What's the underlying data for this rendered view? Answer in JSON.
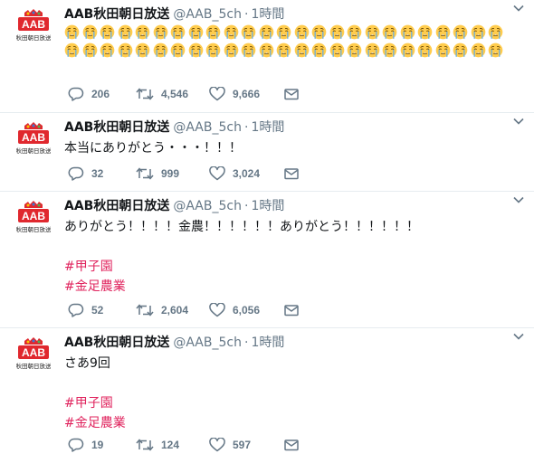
{
  "tweets": [
    {
      "name": "AAB秋田朝日放送",
      "handle": "@AAB_5ch",
      "dot": "·",
      "time": "1時間",
      "emoji_count": 50,
      "emoji_icon": "loudly-crying-face-emoji",
      "replies": "206",
      "retweets": "4,546",
      "likes": "9,666"
    },
    {
      "name": "AAB秋田朝日放送",
      "handle": "@AAB_5ch",
      "dot": "·",
      "time": "1時間",
      "text": "本当にありがとう・・・！！！",
      "replies": "32",
      "retweets": "999",
      "likes": "3,024"
    },
    {
      "name": "AAB秋田朝日放送",
      "handle": "@AAB_5ch",
      "dot": "·",
      "time": "1時間",
      "text": "ありがとう！！！！金農！！！！！！ありがとう！！！！！！",
      "hashtags": [
        "#甲子園",
        "#金足農業"
      ],
      "replies": "52",
      "retweets": "2,604",
      "likes": "6,056"
    },
    {
      "name": "AAB秋田朝日放送",
      "handle": "@AAB_5ch",
      "dot": "·",
      "time": "1時間",
      "text": "さあ9回",
      "hashtags": [
        "#甲子園",
        "#金足農業"
      ],
      "replies": "19",
      "retweets": "124",
      "likes": "597"
    }
  ],
  "avatar": {
    "logo_text": "AAB",
    "sub_text": "秋田朝日放送",
    "brand_color": "#e0282e"
  },
  "colors": {
    "hashtag": "#e0245e",
    "meta": "#657786",
    "divider": "#e6ecf0"
  },
  "icons": {
    "reply": "reply-icon",
    "retweet": "retweet-icon",
    "like": "heart-icon",
    "dm": "envelope-icon",
    "menu": "chevron-down-icon"
  }
}
